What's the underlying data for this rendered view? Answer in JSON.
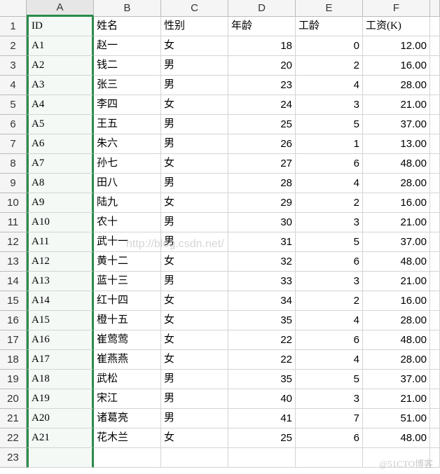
{
  "columns": [
    "A",
    "B",
    "C",
    "D",
    "E",
    "F"
  ],
  "selected_column": "A",
  "headers": {
    "A": "ID",
    "B": "姓名",
    "C": "性别",
    "D": "年龄",
    "E": "工龄",
    "F": "工资(K)"
  },
  "rows": [
    {
      "A": "A1",
      "B": "赵一",
      "C": "女",
      "D": "18",
      "E": "0",
      "F": "12.00"
    },
    {
      "A": "A2",
      "B": "钱二",
      "C": "男",
      "D": "20",
      "E": "2",
      "F": "16.00"
    },
    {
      "A": "A3",
      "B": "张三",
      "C": "男",
      "D": "23",
      "E": "4",
      "F": "28.00"
    },
    {
      "A": "A4",
      "B": "李四",
      "C": "女",
      "D": "24",
      "E": "3",
      "F": "21.00"
    },
    {
      "A": "A5",
      "B": "王五",
      "C": "男",
      "D": "25",
      "E": "5",
      "F": "37.00"
    },
    {
      "A": "A6",
      "B": "朱六",
      "C": "男",
      "D": "26",
      "E": "1",
      "F": "13.00"
    },
    {
      "A": "A7",
      "B": "孙七",
      "C": "女",
      "D": "27",
      "E": "6",
      "F": "48.00"
    },
    {
      "A": "A8",
      "B": "田八",
      "C": "男",
      "D": "28",
      "E": "4",
      "F": "28.00"
    },
    {
      "A": "A9",
      "B": "陆九",
      "C": "女",
      "D": "29",
      "E": "2",
      "F": "16.00"
    },
    {
      "A": "A10",
      "B": "农十",
      "C": "男",
      "D": "30",
      "E": "3",
      "F": "21.00"
    },
    {
      "A": "A11",
      "B": "武十一",
      "C": "男",
      "D": "31",
      "E": "5",
      "F": "37.00"
    },
    {
      "A": "A12",
      "B": "黄十二",
      "C": "女",
      "D": "32",
      "E": "6",
      "F": "48.00"
    },
    {
      "A": "A13",
      "B": "蓝十三",
      "C": "男",
      "D": "33",
      "E": "3",
      "F": "21.00"
    },
    {
      "A": "A14",
      "B": "红十四",
      "C": "女",
      "D": "34",
      "E": "2",
      "F": "16.00"
    },
    {
      "A": "A15",
      "B": "橙十五",
      "C": "女",
      "D": "35",
      "E": "4",
      "F": "28.00"
    },
    {
      "A": "A16",
      "B": "崔莺莺",
      "C": "女",
      "D": "22",
      "E": "6",
      "F": "48.00"
    },
    {
      "A": "A17",
      "B": "崔燕燕",
      "C": "女",
      "D": "22",
      "E": "4",
      "F": "28.00"
    },
    {
      "A": "A18",
      "B": "武松",
      "C": "男",
      "D": "35",
      "E": "5",
      "F": "37.00"
    },
    {
      "A": "A19",
      "B": "宋江",
      "C": "男",
      "D": "40",
      "E": "3",
      "F": "21.00"
    },
    {
      "A": "A20",
      "B": "诸葛亮",
      "C": "男",
      "D": "41",
      "E": "7",
      "F": "51.00"
    },
    {
      "A": "A21",
      "B": "花木兰",
      "C": "女",
      "D": "25",
      "E": "6",
      "F": "48.00"
    }
  ],
  "empty_row_count": 1,
  "watermark1": "http://blog.csdn.net/",
  "watermark2": "@51CTO博客",
  "chart_data": {
    "type": "table",
    "columns": [
      "ID",
      "姓名",
      "性别",
      "年龄",
      "工龄",
      "工资(K)"
    ],
    "rows": [
      [
        "A1",
        "赵一",
        "女",
        18,
        0,
        12.0
      ],
      [
        "A2",
        "钱二",
        "男",
        20,
        2,
        16.0
      ],
      [
        "A3",
        "张三",
        "男",
        23,
        4,
        28.0
      ],
      [
        "A4",
        "李四",
        "女",
        24,
        3,
        21.0
      ],
      [
        "A5",
        "王五",
        "男",
        25,
        5,
        37.0
      ],
      [
        "A6",
        "朱六",
        "男",
        26,
        1,
        13.0
      ],
      [
        "A7",
        "孙七",
        "女",
        27,
        6,
        48.0
      ],
      [
        "A8",
        "田八",
        "男",
        28,
        4,
        28.0
      ],
      [
        "A9",
        "陆九",
        "女",
        29,
        2,
        16.0
      ],
      [
        "A10",
        "农十",
        "男",
        30,
        3,
        21.0
      ],
      [
        "A11",
        "武十一",
        "男",
        31,
        5,
        37.0
      ],
      [
        "A12",
        "黄十二",
        "女",
        32,
        6,
        48.0
      ],
      [
        "A13",
        "蓝十三",
        "男",
        33,
        3,
        21.0
      ],
      [
        "A14",
        "红十四",
        "女",
        34,
        2,
        16.0
      ],
      [
        "A15",
        "橙十五",
        "女",
        35,
        4,
        28.0
      ],
      [
        "A16",
        "崔莺莺",
        "女",
        22,
        6,
        48.0
      ],
      [
        "A17",
        "崔燕燕",
        "女",
        22,
        4,
        28.0
      ],
      [
        "A18",
        "武松",
        "男",
        35,
        5,
        37.0
      ],
      [
        "A19",
        "宋江",
        "男",
        40,
        3,
        21.0
      ],
      [
        "A20",
        "诸葛亮",
        "男",
        41,
        7,
        51.0
      ],
      [
        "A21",
        "花木兰",
        "女",
        25,
        6,
        48.0
      ]
    ]
  }
}
